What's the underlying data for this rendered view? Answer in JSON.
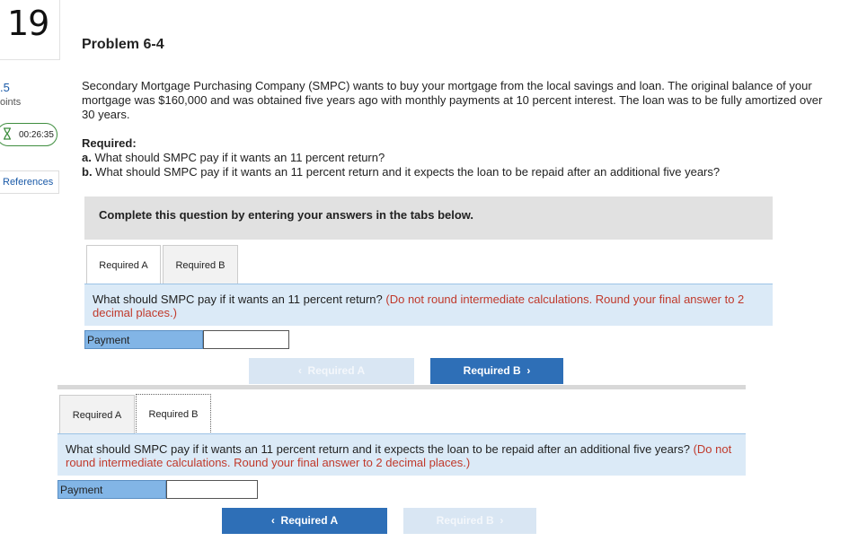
{
  "sidebar": {
    "question_number": "19",
    "points_value": ".5",
    "points_label": "oints",
    "timer": "00:26:35",
    "references_label": "References"
  },
  "problem": {
    "title": "Problem 6-4",
    "text": "Secondary Mortgage Purchasing Company (SMPC) wants to buy your mortgage from the local savings and loan. The original balance of your mortgage was $160,000 and was obtained five years ago with monthly payments at 10 percent interest. The loan was to be fully amortized over 30 years.",
    "required_heading": "Required:",
    "req_a_prefix": "a.",
    "req_a_text": " What should SMPC pay if it wants an 11 percent return?",
    "req_b_prefix": "b.",
    "req_b_text": " What should SMPC pay if it wants an 11 percent return and it  expects the loan to be repaid after an additional five years?"
  },
  "banner": "Complete this question by entering your answers in the tabs below.",
  "panel_a": {
    "tabs": [
      "Required A",
      "Required B"
    ],
    "question": "What should SMPC pay if it wants an 11 percent return?",
    "hint": "(Do not round intermediate calculations. Round your final answer to 2 decimal places.)",
    "field_label": "Payment",
    "field_value": "",
    "prev_button": "Required A",
    "next_button": "Required B"
  },
  "panel_b": {
    "tabs": [
      "Required A",
      "Required B"
    ],
    "question": "What should SMPC pay if it wants an 11 percent return and it  expects the loan to be repaid after an additional five years?",
    "hint": "(Do not round intermediate calculations. Round your final answer to 2 decimal places.)",
    "field_label": "Payment",
    "field_value": "",
    "prev_button": "Required A",
    "next_button": "Required B"
  },
  "colors": {
    "accent": "#2e6fb7",
    "hint": "#c0392b",
    "question_bg": "#dbeaf7"
  }
}
